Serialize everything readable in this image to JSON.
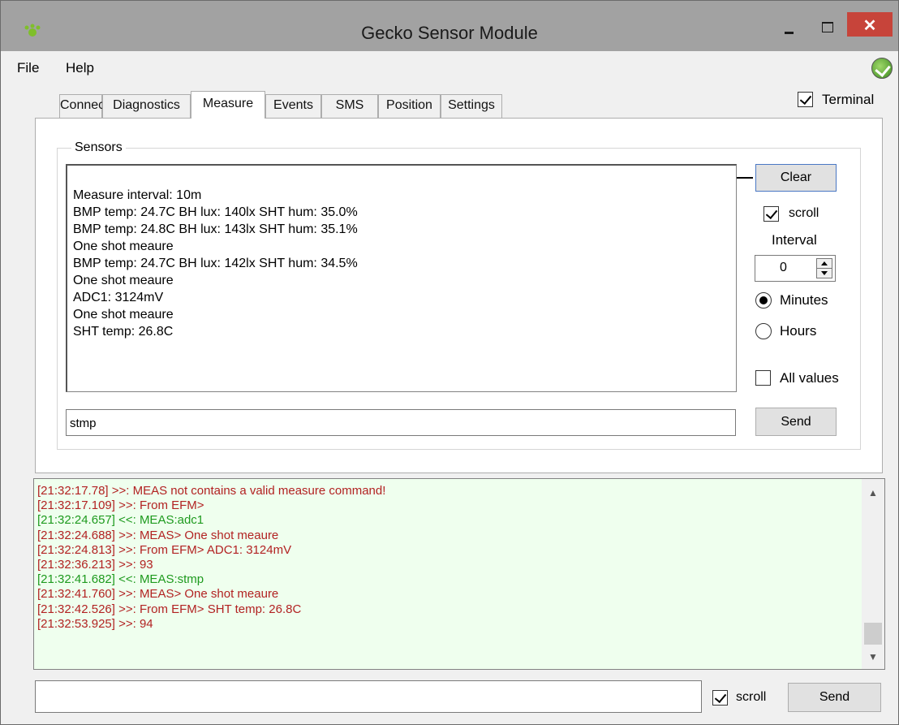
{
  "window": {
    "title": "Gecko Sensor Module",
    "close_glyph": "✕",
    "app_icon": "gecko-paw-icon",
    "accent_close": "#c7443a"
  },
  "menu": {
    "items": [
      "File",
      "Help"
    ],
    "status_icon": "connected-check-icon"
  },
  "tabs": [
    {
      "label": "Connect",
      "active": false
    },
    {
      "label": "Diagnostics",
      "active": false
    },
    {
      "label": "Measure",
      "active": true
    },
    {
      "label": "Events",
      "active": false
    },
    {
      "label": "SMS",
      "active": false
    },
    {
      "label": "Position",
      "active": false
    },
    {
      "label": "Settings",
      "active": false
    }
  ],
  "terminal_toggle": {
    "label": "Terminal",
    "checked": true
  },
  "sensors": {
    "group_title": "Sensors",
    "log_lines": [
      "Measure interval: 10m",
      "BMP temp: 24.7C BH lux: 140lx SHT hum: 35.0%",
      "BMP temp: 24.8C BH lux: 143lx SHT hum: 35.1%",
      "One shot meaure",
      "BMP temp: 24.7C BH lux: 142lx SHT hum: 34.5%",
      "One shot meaure",
      "ADC1: 3124mV",
      "One shot meaure",
      "SHT temp: 26.8C"
    ],
    "clear_label": "Clear",
    "scroll_label": "scroll",
    "scroll_checked": true,
    "interval_label": "Interval",
    "interval_value": "0",
    "unit_minutes": "Minutes",
    "unit_hours": "Hours",
    "selected_unit": "Minutes",
    "all_values_label": "All values",
    "all_values_checked": false,
    "command_value": "stmp",
    "send_label": "Send"
  },
  "terminal": {
    "colors": {
      "received": "#b22222",
      "sent": "#1e9a1e"
    },
    "lines": [
      {
        "text": "[21:32:17.78] >>: MEAS not contains a valid measure command!",
        "dir": "received"
      },
      {
        "text": "[21:32:17.109] >>: From EFM>",
        "dir": "received"
      },
      {
        "text": "[21:32:24.657] <<: MEAS:adc1",
        "dir": "sent"
      },
      {
        "text": "[21:32:24.688] >>: MEAS> One shot meaure",
        "dir": "received"
      },
      {
        "text": "[21:32:24.813] >>: From EFM> ADC1: 3124mV",
        "dir": "received"
      },
      {
        "text": "[21:32:36.213] >>: 93",
        "dir": "received"
      },
      {
        "text": "[21:32:41.682] <<: MEAS:stmp",
        "dir": "sent"
      },
      {
        "text": "[21:32:41.760] >>: MEAS> One shot meaure",
        "dir": "received"
      },
      {
        "text": "[21:32:42.526] >>: From EFM> SHT temp: 26.8C",
        "dir": "received"
      },
      {
        "text": "[21:32:53.925] >>: 94",
        "dir": "received"
      }
    ],
    "input_value": "",
    "scroll_label": "scroll",
    "scroll_checked": true,
    "send_label": "Send"
  }
}
